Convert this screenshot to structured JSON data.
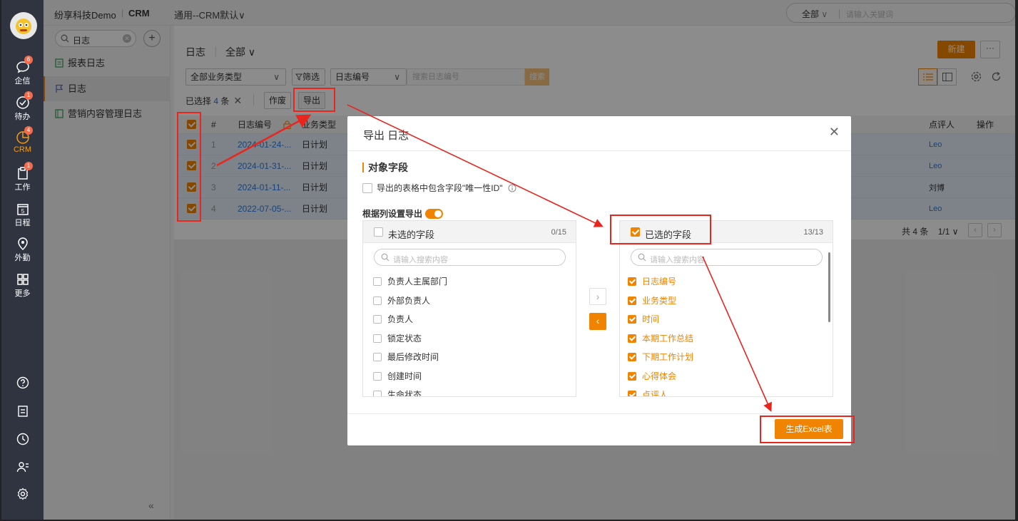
{
  "topbar": {
    "tenant": "纷享科技Demo",
    "separator": "|",
    "app": "CRM",
    "scene": "通用--CRM默认∨",
    "search_scope": "全部",
    "search_placeholder": "请输入关键词"
  },
  "rail": {
    "items": [
      {
        "label": "企信",
        "badge": "6",
        "icon": "chat-icon"
      },
      {
        "label": "待办",
        "badge": "1",
        "icon": "check-circle-icon"
      },
      {
        "label": "CRM",
        "badge": "4",
        "icon": "pie-chart-icon",
        "active": true
      },
      {
        "label": "工作",
        "badge": "1",
        "icon": "clipboard-icon"
      },
      {
        "label": "日程",
        "badge": "",
        "icon": "calendar-icon",
        "calendar_day": "5"
      },
      {
        "label": "外勤",
        "badge": "",
        "icon": "location-pin-icon"
      },
      {
        "label": "更多",
        "badge": "",
        "icon": "grid-icon"
      }
    ]
  },
  "sidebar": {
    "search_value": "日志",
    "items": [
      {
        "label": "报表日志",
        "icon": "report-icon"
      },
      {
        "label": "日志",
        "icon": "flag-icon",
        "active": true
      },
      {
        "label": "营销内容管理日志",
        "icon": "book-icon"
      }
    ],
    "collapse": "«"
  },
  "page": {
    "title": "日志",
    "filter_scope": "全部 ∨",
    "new_button": "新建",
    "more_button": "···",
    "type_select": "全部业务类型",
    "filter_button": "筛选",
    "field_select": "日志编号",
    "search_placeholder": "搜索日志编号",
    "search_button": "搜索",
    "selected_prefix": "已选择",
    "selected_count": "4",
    "selected_suffix": "条",
    "void_button": "作废",
    "export_button": "导出"
  },
  "table": {
    "headers": [
      "#",
      "日志编号",
      "业务类型",
      "点评人",
      "操作"
    ],
    "rows": [
      {
        "index": "1",
        "id": "2024-01-24-...",
        "type": "日计划",
        "reviewer": "Leo",
        "reviewer_link": true
      },
      {
        "index": "2",
        "id": "2024-01-31-...",
        "type": "日计划",
        "reviewer": "Leo",
        "reviewer_link": true
      },
      {
        "index": "3",
        "id": "2024-01-11-...",
        "type": "日计划",
        "reviewer": "刘博",
        "reviewer_link": false
      },
      {
        "index": "4",
        "id": "2022-07-05-...",
        "type": "日计划",
        "reviewer": "Leo",
        "reviewer_link": true
      }
    ],
    "total": "共 4 条",
    "page": "1/1 ∨"
  },
  "modal": {
    "title": "导出 日志",
    "section_title": "对象字段",
    "unique_id_option": "导出的表格中包含字段\"唯一性ID\"",
    "column_setting": "根据列设置导出",
    "unselected": {
      "title": "未选的字段",
      "count": "0/15",
      "search_placeholder": "请输入搜索内容",
      "fields": [
        "负责人主属部门",
        "外部负责人",
        "负责人",
        "锁定状态",
        "最后修改时间",
        "创建时间",
        "生命状态"
      ]
    },
    "selected": {
      "title": "已选的字段",
      "count": "13/13",
      "search_placeholder": "请输入搜索内容",
      "fields": [
        "日志编号",
        "业务类型",
        "时间",
        "本期工作总结",
        "下期工作计划",
        "心得体会",
        "点评人"
      ]
    },
    "generate_button": "生成Excel表"
  },
  "colors": {
    "accent": "#f08300",
    "link": "#2a7be0",
    "annotation": "#e8261e"
  }
}
